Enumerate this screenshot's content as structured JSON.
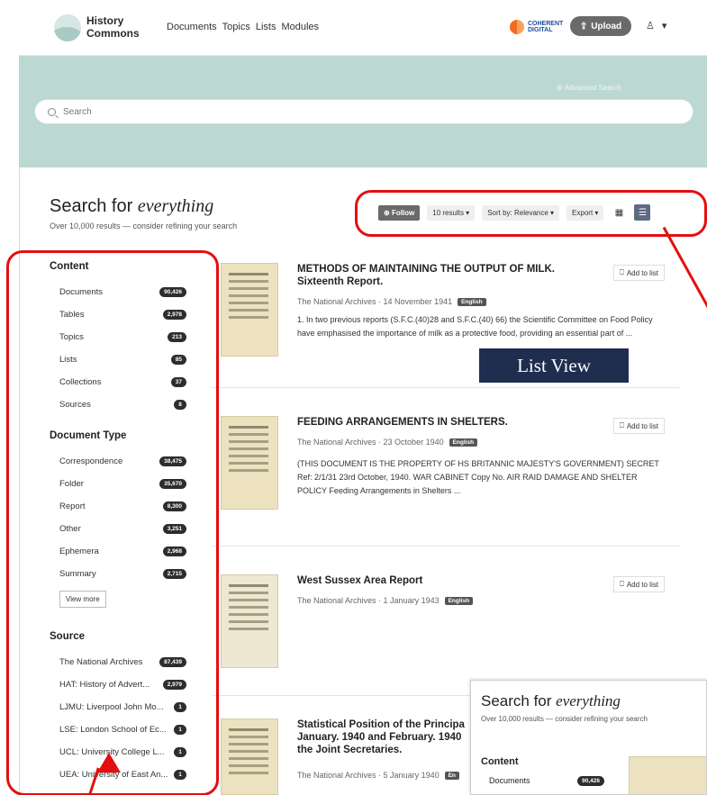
{
  "header": {
    "logo_line1": "History",
    "logo_line2": "Commons",
    "nav": [
      "Documents",
      "Topics",
      "Lists",
      "Modules"
    ],
    "partner_line1": "COHERENT",
    "partner_line2": "DIGITAL",
    "upload_label": "Upload"
  },
  "hero": {
    "advanced_search": "Advanced Search",
    "search_placeholder": "Search"
  },
  "results": {
    "title_prefix": "Search for",
    "title_emph": "everything",
    "subtitle": "Over 10,000 results — consider refining your search"
  },
  "toolbar": {
    "follow": "Follow",
    "per_page": "10 results",
    "sort": "Sort by: Relevance",
    "export": "Export"
  },
  "sidebar": {
    "content": {
      "heading": "Content",
      "items": [
        {
          "label": "Documents",
          "count": "90,426"
        },
        {
          "label": "Tables",
          "count": "2,978"
        },
        {
          "label": "Topics",
          "count": "213"
        },
        {
          "label": "Lists",
          "count": "85"
        },
        {
          "label": "Collections",
          "count": "37"
        },
        {
          "label": "Sources",
          "count": "8"
        }
      ]
    },
    "doc_type": {
      "heading": "Document Type",
      "items": [
        {
          "label": "Correspondence",
          "count": "38,475"
        },
        {
          "label": "Folder",
          "count": "35,670"
        },
        {
          "label": "Report",
          "count": "8,300"
        },
        {
          "label": "Other",
          "count": "3,251"
        },
        {
          "label": "Ephemera",
          "count": "2,968"
        },
        {
          "label": "Summary",
          "count": "2,715"
        }
      ],
      "view_more": "View more"
    },
    "source": {
      "heading": "Source",
      "items": [
        {
          "label": "The National Archives",
          "count": "87,439"
        },
        {
          "label": "HAT: History of Advert...",
          "count": "2,979"
        },
        {
          "label": "LJMU: Liverpool John Mo...",
          "count": "1"
        },
        {
          "label": "LSE: London School of Ec...",
          "count": "1"
        },
        {
          "label": "UCL: University College L...",
          "count": "1"
        },
        {
          "label": "UEA: University of East An...",
          "count": "1"
        }
      ]
    }
  },
  "cards": [
    {
      "title": "METHODS OF MAINTAINING THE OUTPUT OF MILK. Sixteenth Report.",
      "meta": "The National Archives · 14 November 1941",
      "lang": "English",
      "desc": "1. In two previous reports (S.F.C.(40)28 and S.F.C.(40) 66) the Scientific Committee on Food Policy have emphasised the importance of milk as a protective food, providing an essential part of ...",
      "add": "Add to list"
    },
    {
      "title": "FEEDING ARRANGEMENTS IN SHELTERS.",
      "meta": "The National Archives · 23 October 1940",
      "lang": "English",
      "desc": "(THIS DOCUMENT IS THE PROPERTY OF HS BRITANNIC MAJESTY'S GOVERNMENT) SECRET Ref: 2/1/31 23rd October, 1940. WAR CABINET Copy No. AIR RAID DAMAGE AND SHELTER POLICY Feeding Arrangements in Shelters ...",
      "add": "Add to list"
    },
    {
      "title": "West Sussex Area Report",
      "meta": "The National Archives · 1 January 1943",
      "lang": "English",
      "desc": "",
      "add": "Add to list"
    },
    {
      "title": "Statistical Position of the Principa January. 1940 and February. 1940 the Joint Secretaries.",
      "meta": "The National Archives · 5 January 1940",
      "lang": "En",
      "desc": "",
      "add": ""
    }
  ],
  "annotation": {
    "label": "List View"
  },
  "inset": {
    "title_prefix": "Search for",
    "title_emph": "everything",
    "subtitle": "Over 10,000 results — consider refining your search",
    "heading": "Content",
    "row_label": "Documents",
    "row_count": "90,426"
  }
}
